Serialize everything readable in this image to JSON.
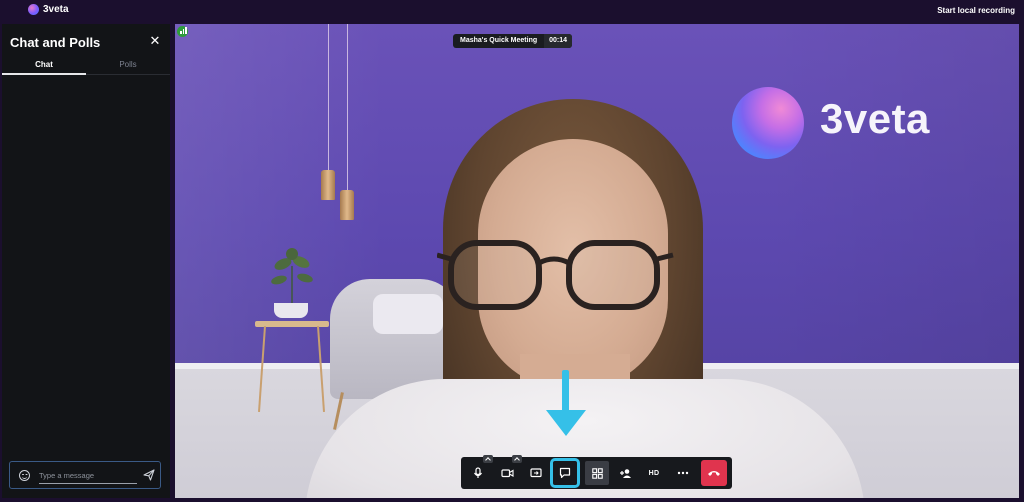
{
  "app": {
    "name": "3veta",
    "top_action": "Start local recording"
  },
  "sidebar": {
    "title": "Chat and Polls",
    "close_symbol": "✕",
    "tabs": [
      {
        "label": "Chat",
        "active": true
      },
      {
        "label": "Polls",
        "active": false
      }
    ],
    "compose": {
      "placeholder": "Type a message",
      "value": "",
      "emoji_icon": "emoji-smile-icon",
      "send_icon": "send-icon"
    }
  },
  "meeting": {
    "title": "Masha's Quick Meeting",
    "elapsed": "00:14",
    "background_brand_text": "3veta"
  },
  "toolbar": {
    "buttons": [
      {
        "id": "mic",
        "icon": "microphone-icon",
        "has_menu": true
      },
      {
        "id": "camera",
        "icon": "camera-icon",
        "has_menu": true
      },
      {
        "id": "screen-share",
        "icon": "screen-share-icon"
      },
      {
        "id": "chat",
        "icon": "chat-bubble-icon",
        "active": true
      },
      {
        "id": "layout",
        "icon": "grid-layout-icon",
        "active": true
      },
      {
        "id": "add-participant",
        "icon": "add-person-icon"
      },
      {
        "id": "quality",
        "label": "HD"
      },
      {
        "id": "more",
        "icon": "more-dots-icon"
      },
      {
        "id": "end-call",
        "icon": "phone-hangup-icon"
      }
    ],
    "hd_label": "HD"
  },
  "colors": {
    "topbar_bg": "#1b0f2e",
    "sidebar_bg": "#121417",
    "highlight": "#35c0e8",
    "end_call": "#e0344e",
    "wall": "#6a52b8"
  }
}
